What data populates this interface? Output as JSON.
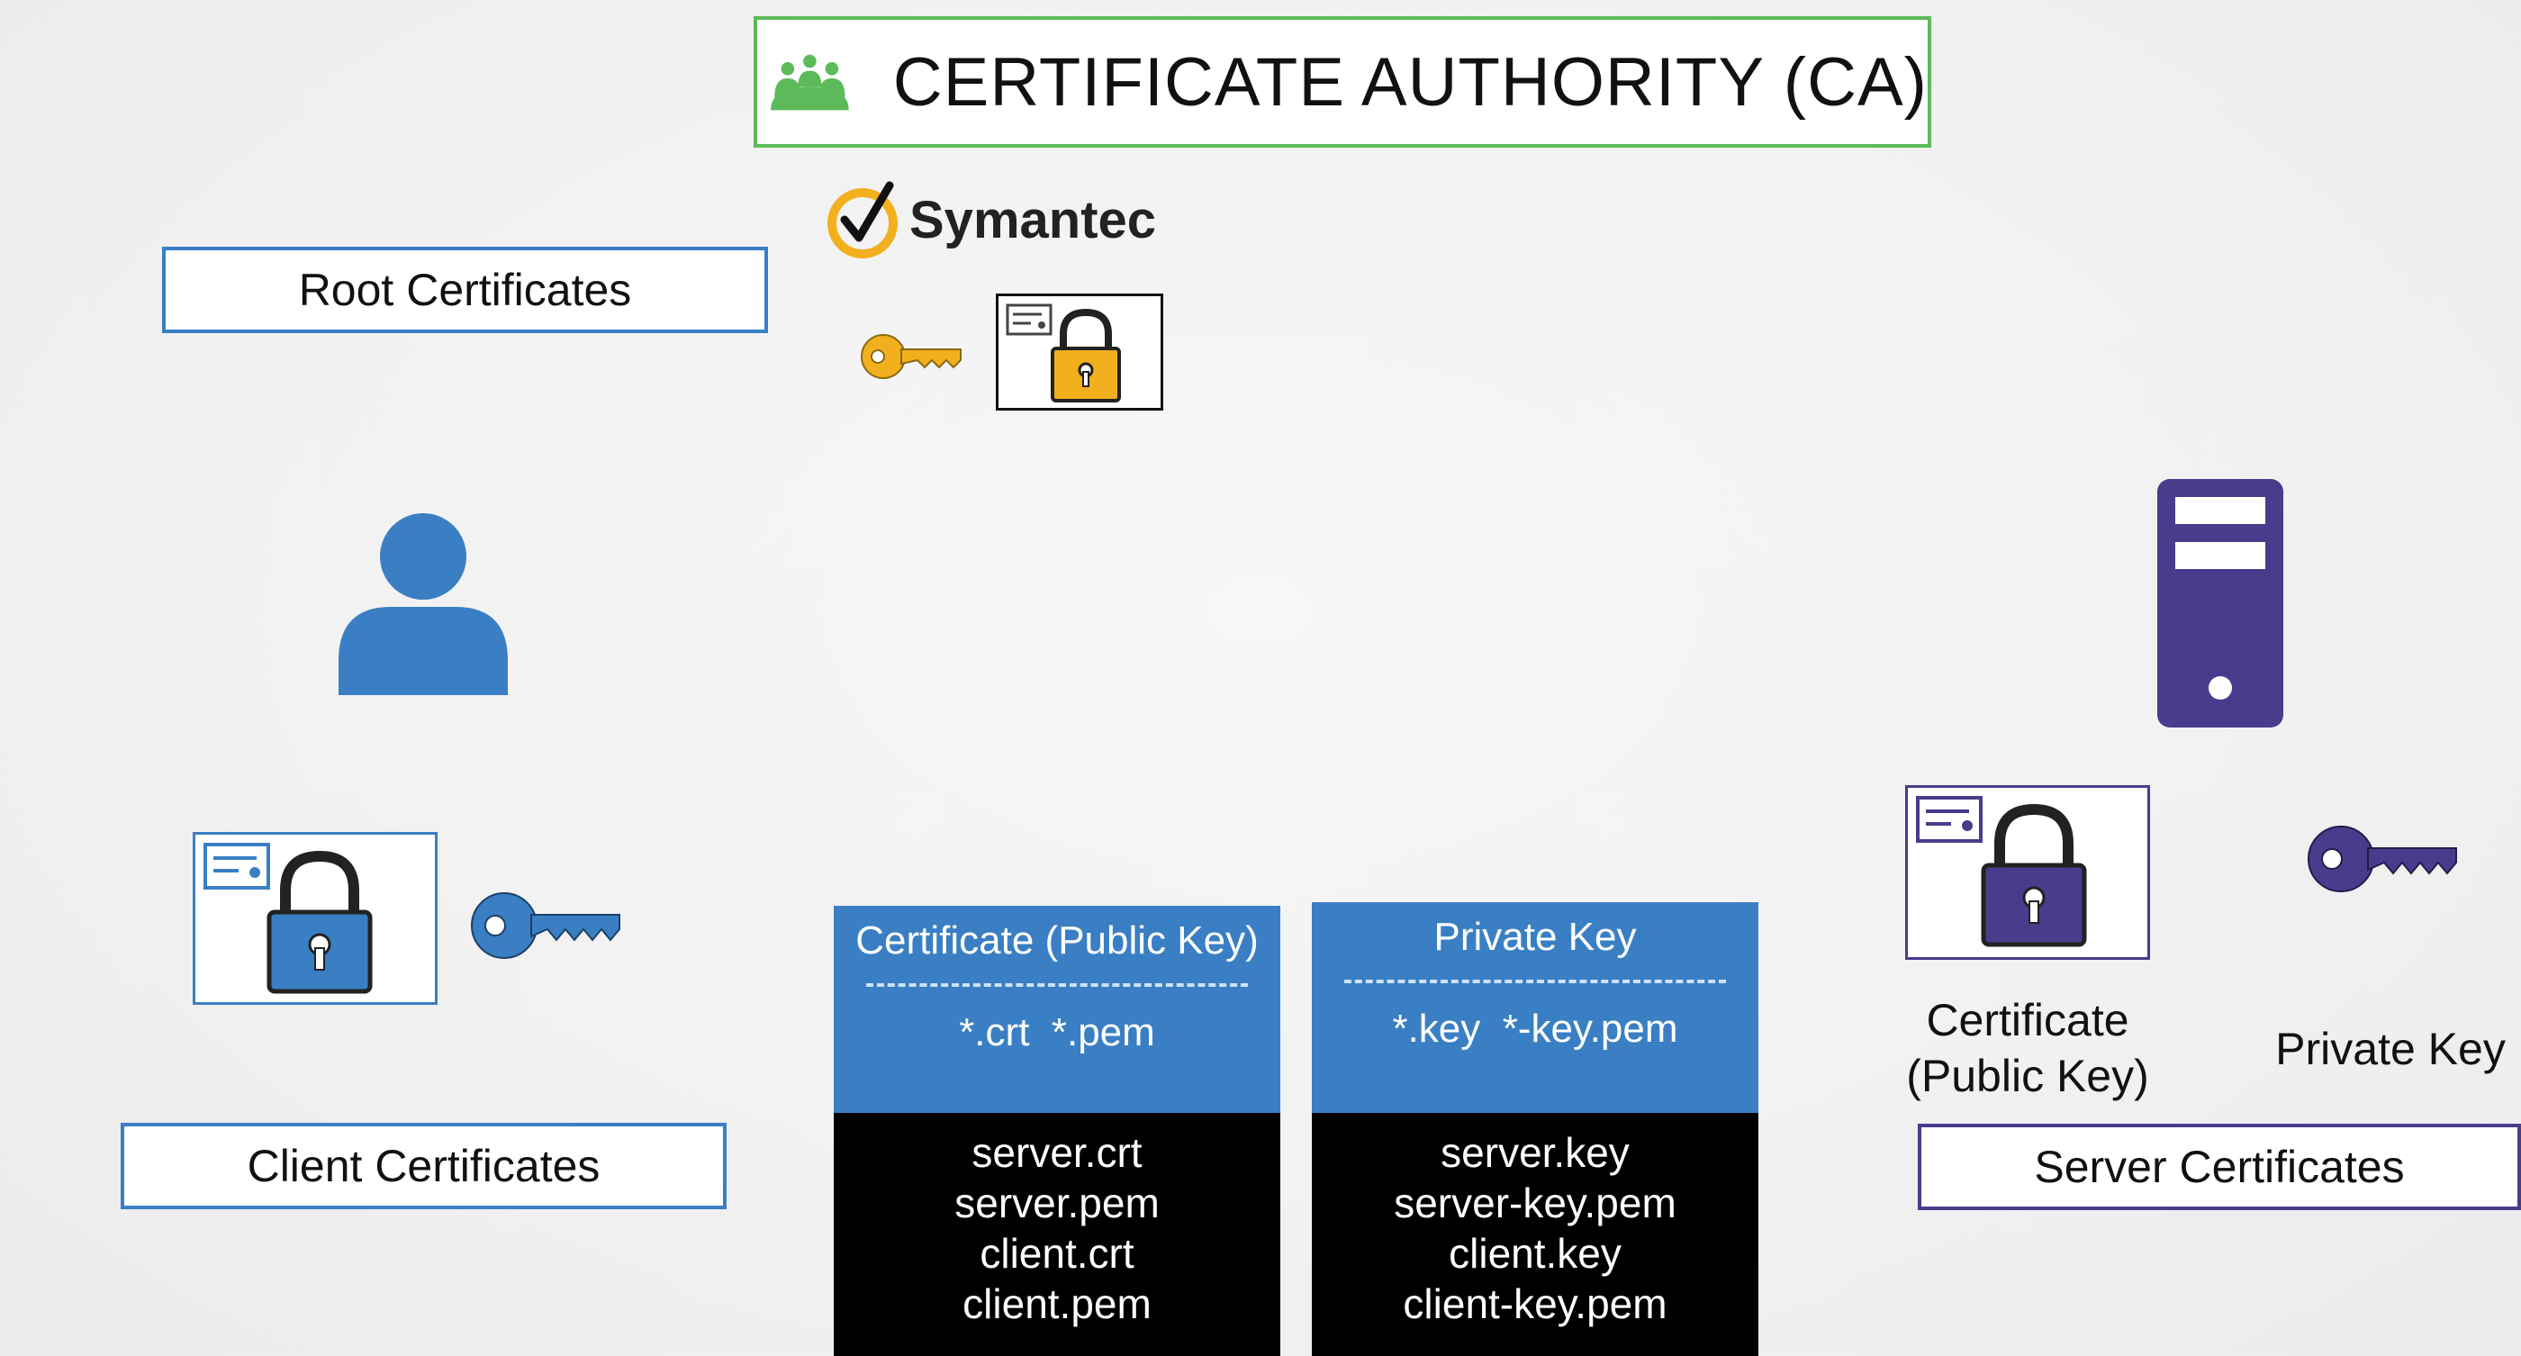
{
  "ca": {
    "title": "CERTIFICATE AUTHORITY (CA)",
    "icon": "group-people-icon"
  },
  "symantec": {
    "brand": "Symantec"
  },
  "labels": {
    "root": "Root Certificates",
    "client": "Client Certificates",
    "server": "Server Certificates"
  },
  "table": {
    "public": {
      "title": "Certificate (Public Key)",
      "ext": "*.crt  *.pem",
      "files": [
        "server.crt",
        "server.pem",
        "client.crt",
        "client.pem"
      ]
    },
    "private": {
      "title": "Private Key",
      "ext": "*.key  *-key.pem",
      "files": [
        "server.key",
        "server-key.pem",
        "client.key",
        "client-key.pem"
      ]
    }
  },
  "server_side": {
    "cert_caption_line1": "Certificate",
    "cert_caption_line2": "(Public Key)",
    "key_caption": "Private Key"
  },
  "colors": {
    "green": "#5dba5a",
    "blue": "#3a7fc4",
    "purple": "#4a3c8c",
    "gold": "#f2b01e"
  }
}
